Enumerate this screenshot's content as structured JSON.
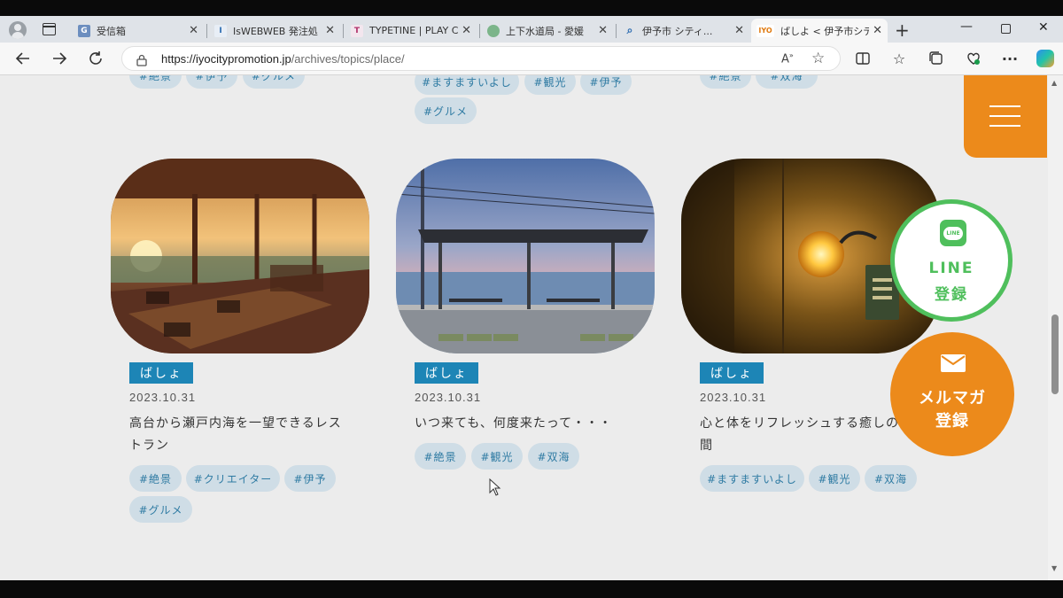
{
  "browser": {
    "tabs": [
      {
        "label": "受信箱",
        "favicon": "G"
      },
      {
        "label": "IsWEBWEB 発注処",
        "favicon": "I"
      },
      {
        "label": "TYPETINE | PLAY C",
        "favicon": "T"
      },
      {
        "label": "上下水道局 - 愛媛",
        "favicon": ""
      },
      {
        "label": "伊予市 シティ...",
        "favicon": ""
      },
      {
        "label": "ばしよ < 伊予市シテ",
        "favicon": "IYO"
      }
    ],
    "url_host": "https://iyocitypromotion.jp",
    "url_path": "/archives/topics/place/"
  },
  "top_row": {
    "col1_tags": [
      "#絶景",
      "#伊予",
      "#グルメ"
    ],
    "col2_tags": [
      "#ますますいよし",
      "#観光",
      "#伊予",
      "#グルメ"
    ],
    "col3_tags": [
      "#絶景",
      "#双海"
    ]
  },
  "cards": [
    {
      "category": "ばしょ",
      "date": "2023.10.31",
      "title_line1": "高台から瀬戸内海を一望できるレス",
      "title_line2": "トラン",
      "tags": [
        "#絶景",
        "#クリエイター",
        "#伊予",
        "#グルメ"
      ]
    },
    {
      "category": "ばしょ",
      "date": "2023.10.31",
      "title_line1": "いつ来ても、何度来たって・・・",
      "title_line2": "",
      "tags": [
        "#絶景",
        "#観光",
        "#双海"
      ]
    },
    {
      "category": "ばしょ",
      "date": "2023.10.31",
      "title_line1": "心と体をリフレッシュする癒しの空",
      "title_line2": "間",
      "tags": [
        "#ますますいよし",
        "#観光",
        "#双海"
      ]
    }
  ],
  "floating": {
    "line_label1": "LINE",
    "line_label2": "登録",
    "mail_label1": "メルマガ",
    "mail_label2": "登録"
  },
  "colors": {
    "accent_orange": "#ec8a1b",
    "line_green": "#4fbf5c",
    "category_blue": "#1d85b6",
    "tag_bg": "#cfdde6"
  }
}
